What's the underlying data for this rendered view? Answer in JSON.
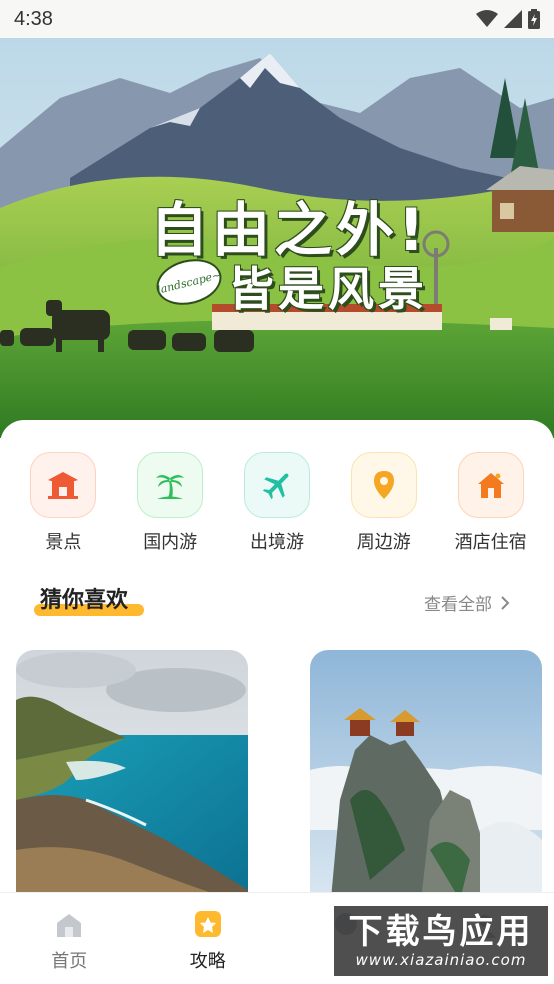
{
  "status_bar": {
    "time": "4:38"
  },
  "hero": {
    "title_line1": "自由之外!",
    "title_line2": "皆是风景",
    "bubble_text": "landscape~"
  },
  "categories": [
    {
      "label": "景点",
      "icon": "scenic-spot-icon",
      "color": "#ee5a34",
      "bg": "#fff1ec",
      "border": "#ffd2c2"
    },
    {
      "label": "国内游",
      "icon": "palm-tree-icon",
      "color": "#2fbf5a",
      "bg": "#eefbf1",
      "border": "#bfeecb"
    },
    {
      "label": "出境游",
      "icon": "airplane-icon",
      "color": "#23bfa2",
      "bg": "#ebfaf6",
      "border": "#b9ece0"
    },
    {
      "label": "周边游",
      "icon": "location-pin-icon",
      "color": "#f5a623",
      "bg": "#fff8e8",
      "border": "#fde3b0"
    },
    {
      "label": "酒店住宿",
      "icon": "hotel-icon",
      "color": "#f47a20",
      "bg": "#fff2e8",
      "border": "#fdd4b6"
    }
  ],
  "section": {
    "title": "猜你喜欢",
    "view_all": "查看全部"
  },
  "bottom_nav": [
    {
      "label": "首页",
      "icon": "home-icon",
      "active": false
    },
    {
      "label": "攻略",
      "icon": "guide-star-icon",
      "active": true
    },
    {
      "label": "",
      "icon": "",
      "active": false
    },
    {
      "label": "",
      "icon": "",
      "active": false
    }
  ],
  "watermark": {
    "big": "下载鸟应用",
    "small": "www.xiazainiao.com"
  },
  "colors": {
    "accent": "#ffb92e",
    "text": "#222222",
    "muted": "#888888"
  }
}
